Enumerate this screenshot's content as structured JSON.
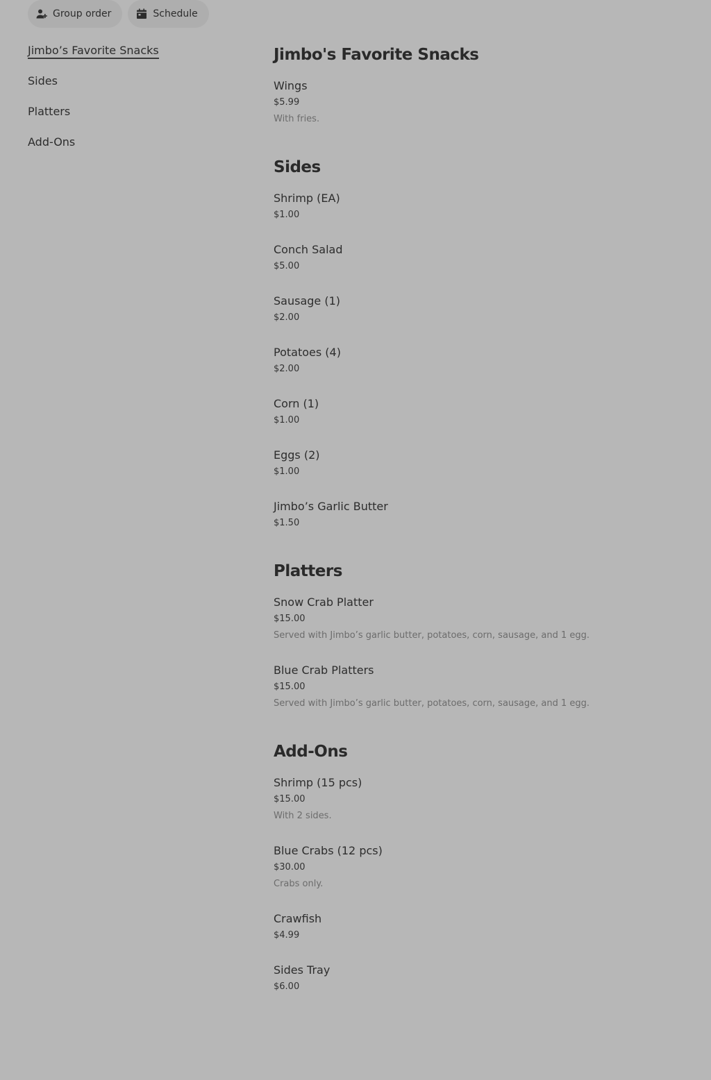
{
  "toolbar": {
    "group_order_label": "Group order",
    "schedule_label": "Schedule"
  },
  "sidebar": {
    "items": [
      {
        "label": "Jimbo’s Favorite Snacks"
      },
      {
        "label": "Sides"
      },
      {
        "label": "Platters"
      },
      {
        "label": "Add-Ons"
      }
    ]
  },
  "menu": {
    "sections": [
      {
        "title": "Jimbo's Favorite Snacks",
        "items": [
          {
            "name": "Wings",
            "price": "$5.99",
            "desc": "With fries."
          }
        ]
      },
      {
        "title": "Sides",
        "items": [
          {
            "name": "Shrimp (EA)",
            "price": "$1.00"
          },
          {
            "name": "Conch Salad",
            "price": "$5.00"
          },
          {
            "name": "Sausage (1)",
            "price": "$2.00"
          },
          {
            "name": "Potatoes (4)",
            "price": "$2.00"
          },
          {
            "name": "Corn (1)",
            "price": "$1.00"
          },
          {
            "name": "Eggs (2)",
            "price": "$1.00"
          },
          {
            "name": "Jimbo’s Garlic Butter",
            "price": "$1.50"
          }
        ]
      },
      {
        "title": "Platters",
        "items": [
          {
            "name": "Snow Crab Platter",
            "price": "$15.00",
            "desc": "Served with Jimbo’s garlic butter, potatoes, corn, sausage, and 1 egg."
          },
          {
            "name": "Blue Crab Platters",
            "price": "$15.00",
            "desc": "Served with Jimbo’s garlic butter, potatoes, corn, sausage, and 1 egg."
          }
        ]
      },
      {
        "title": "Add-Ons",
        "items": [
          {
            "name": "Shrimp (15 pcs)",
            "price": "$15.00",
            "desc": "With 2 sides."
          },
          {
            "name": "Blue Crabs (12 pcs)",
            "price": "$30.00",
            "desc": "Crabs only."
          },
          {
            "name": "Crawfish",
            "price": "$4.99"
          },
          {
            "name": "Sides Tray",
            "price": "$6.00"
          }
        ]
      }
    ]
  },
  "colors": {
    "background": "#b7b7b7",
    "pill_background": "#aeaeae",
    "text": "#2d2d2d",
    "description": "#6c6c6c"
  }
}
